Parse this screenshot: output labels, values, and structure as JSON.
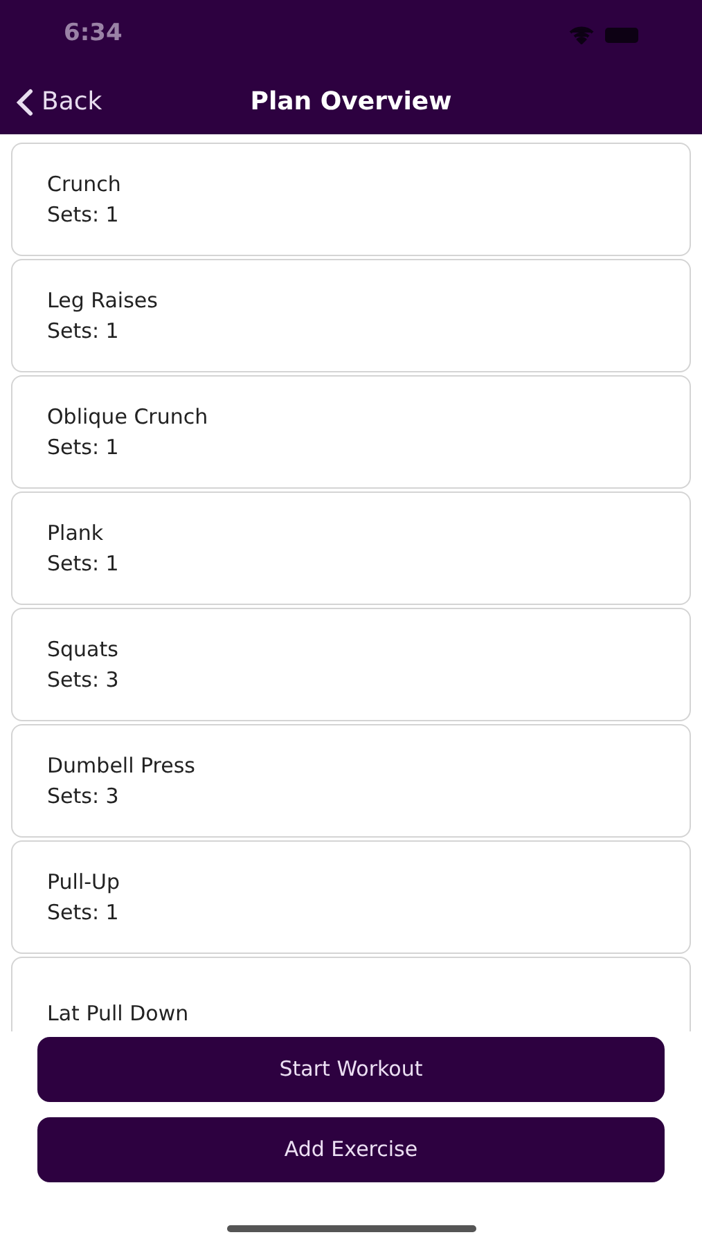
{
  "status_bar": {
    "time": "6:34"
  },
  "nav": {
    "back": "Back",
    "title": "Plan Overview"
  },
  "exercises": [
    {
      "name": "Crunch",
      "sets": "Sets:  1"
    },
    {
      "name": "Leg Raises",
      "sets": "Sets:  1"
    },
    {
      "name": "Oblique Crunch",
      "sets": "Sets:  1"
    },
    {
      "name": "Plank",
      "sets": "Sets:  1"
    },
    {
      "name": "Squats",
      "sets": "Sets:  3"
    },
    {
      "name": "Dumbell Press",
      "sets": "Sets:  3"
    },
    {
      "name": "Pull-Up",
      "sets": "Sets:  1"
    },
    {
      "name": "Lat Pull Down"
    }
  ],
  "buttons": [
    "Start Workout",
    "Add Exercise"
  ]
}
